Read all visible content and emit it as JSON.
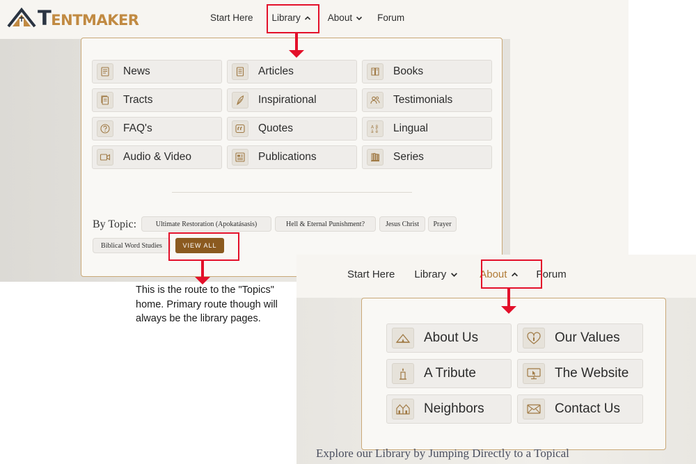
{
  "library_screenshot": {
    "logo": {
      "part1": "T",
      "part2": "ENTMAKER"
    },
    "nav": [
      {
        "label": "Start Here",
        "chevron": ""
      },
      {
        "label": "Library",
        "chevron": "chevron-up-icon"
      },
      {
        "label": "About",
        "chevron": "chevron-down-icon"
      },
      {
        "label": "Forum",
        "chevron": ""
      }
    ],
    "library_menu": {
      "items": [
        {
          "label": "News",
          "icon": "newspaper-icon"
        },
        {
          "label": "Articles",
          "icon": "document-icon"
        },
        {
          "label": "Books",
          "icon": "book-icon"
        },
        {
          "label": "Tracts",
          "icon": "pamphlet-icon"
        },
        {
          "label": "Inspirational",
          "icon": "feather-icon"
        },
        {
          "label": "Testimonials",
          "icon": "people-icon"
        },
        {
          "label": "FAQ's",
          "icon": "question-icon"
        },
        {
          "label": "Quotes",
          "icon": "quote-icon"
        },
        {
          "label": "Lingual",
          "icon": "alphabet-icon"
        },
        {
          "label": "Audio & Video",
          "icon": "video-icon"
        },
        {
          "label": "Publications",
          "icon": "newsletter-icon"
        },
        {
          "label": "Series",
          "icon": "bookshelf-icon"
        }
      ],
      "by_topic_label": "By Topic:",
      "topics": [
        "Ultimate Restoration (Apokatásasis)",
        "Hell & Eternal Punishment?",
        "Jesus Christ",
        "Prayer",
        "Biblical Word Studies"
      ],
      "view_all_label": "VIEW ALL"
    }
  },
  "annotation_note": "This is the route to the \"Topics\" home. Primary route though will always be the library pages.",
  "about_screenshot": {
    "nav": [
      {
        "label": "Start Here",
        "chevron": ""
      },
      {
        "label": "Library",
        "chevron": "chevron-down-icon"
      },
      {
        "label": "About",
        "chevron": "chevron-up-icon"
      },
      {
        "label": "Forum",
        "chevron": ""
      }
    ],
    "about_menu": {
      "items": [
        {
          "label": "About Us",
          "icon": "tent-icon"
        },
        {
          "label": "Our Values",
          "icon": "heart-candle-icon"
        },
        {
          "label": "A Tribute",
          "icon": "candle-icon"
        },
        {
          "label": "The Website",
          "icon": "monitor-icon"
        },
        {
          "label": "Neighbors",
          "icon": "houses-icon"
        },
        {
          "label": "Contact Us",
          "icon": "envelope-icon"
        }
      ]
    },
    "explore_text": "Explore our Library by Jumping Directly to a Topical"
  },
  "colors": {
    "accent_brown": "#8b5a1f",
    "annotation_red": "#e3102a",
    "panel_border": "#c9a877",
    "about_active": "#b07a35"
  }
}
